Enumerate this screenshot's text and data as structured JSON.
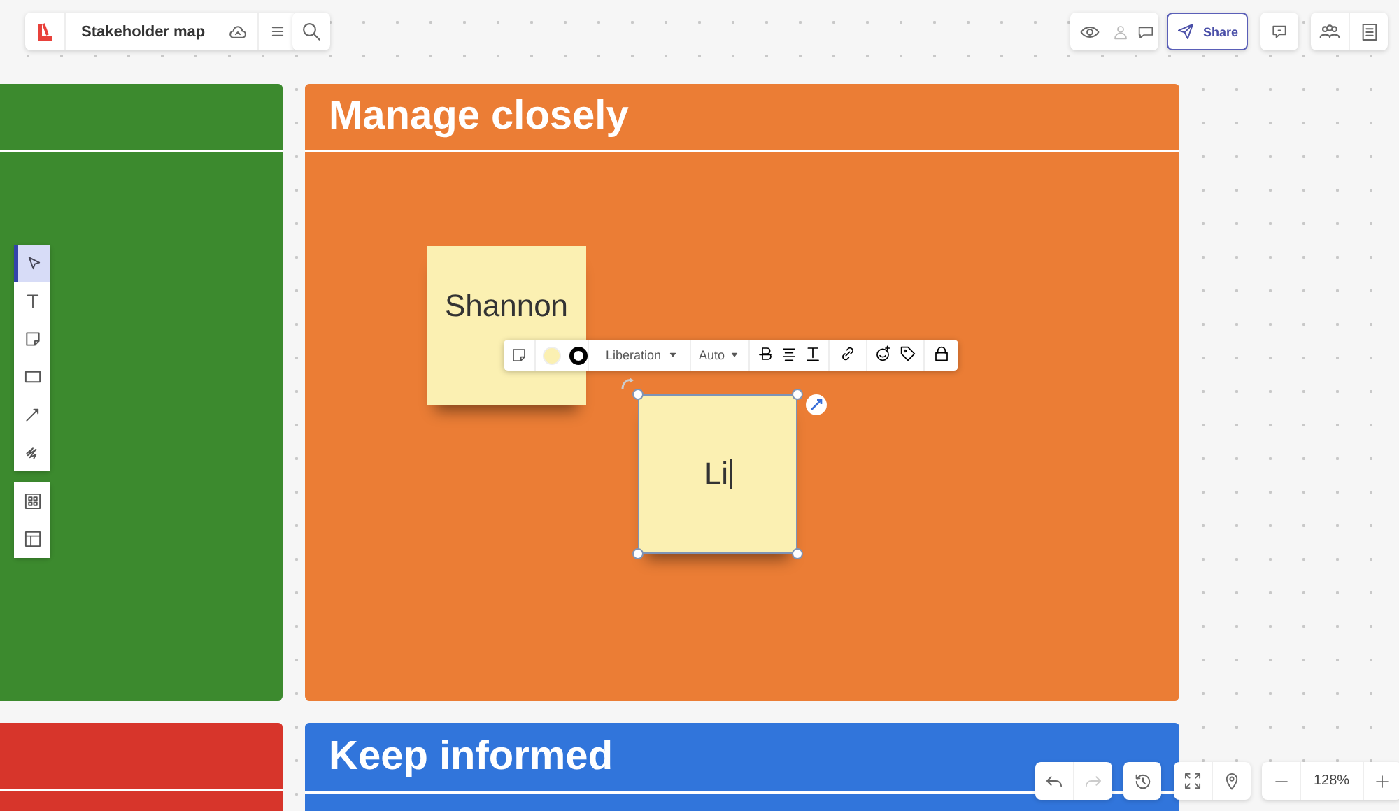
{
  "board": {
    "title": "Stakeholder map"
  },
  "share_button": {
    "label": "Share"
  },
  "tools": [
    {
      "kind": "select",
      "selected": true
    },
    {
      "kind": "text",
      "selected": false
    },
    {
      "kind": "sticky",
      "selected": false
    },
    {
      "kind": "rectangle",
      "selected": false
    },
    {
      "kind": "line",
      "selected": false
    },
    {
      "kind": "pen",
      "selected": false
    }
  ],
  "extra_tools": [
    {
      "kind": "templates",
      "selected": false
    },
    {
      "kind": "layout",
      "selected": false
    }
  ],
  "frames": [
    {
      "color": "#3c8a2e"
    },
    {
      "title": "Manage closely",
      "color": "#eb7d35"
    },
    {
      "color": "#d7352b"
    },
    {
      "title": "Keep informed",
      "color": "#3175db"
    }
  ],
  "stickies": [
    {
      "text": "Shannon",
      "color": "#fbf0b2",
      "selected": false
    },
    {
      "text": "Li",
      "color": "#fbf0b2",
      "selected": true
    }
  ],
  "format_toolbar": {
    "font": "Liberation",
    "size": "Auto"
  },
  "zoom": {
    "level_text": "128%"
  }
}
